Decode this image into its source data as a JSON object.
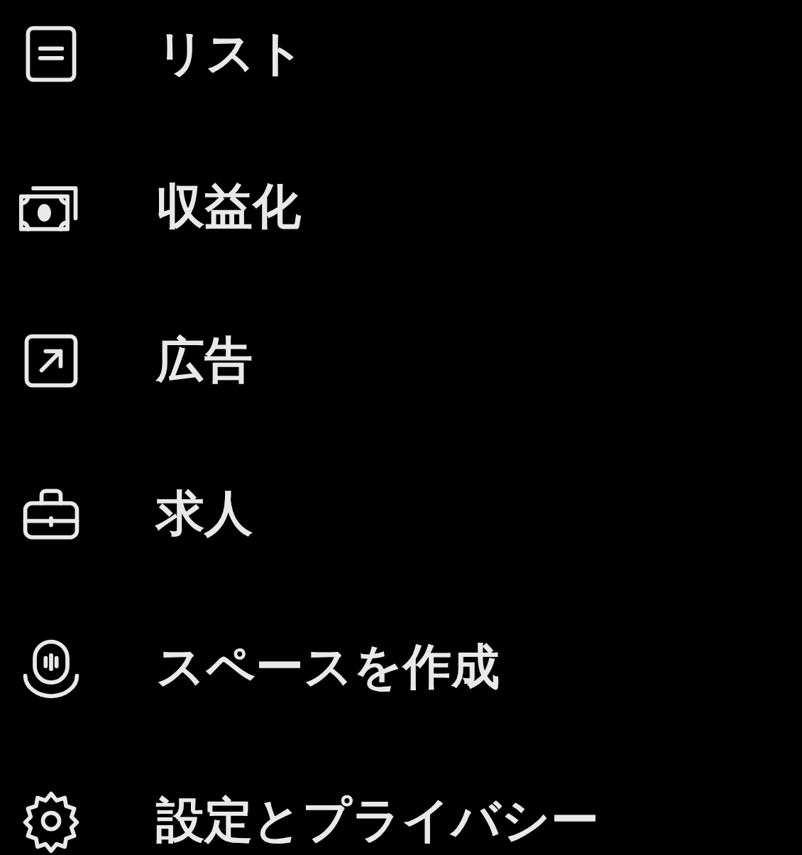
{
  "menu": [
    {
      "kind": "list",
      "label": "リスト"
    },
    {
      "kind": "money",
      "label": "収益化"
    },
    {
      "kind": "ads",
      "label": "広告"
    },
    {
      "kind": "jobs",
      "label": "求人"
    },
    {
      "kind": "spaces",
      "label": "スペースを作成"
    },
    {
      "kind": "settings",
      "label": "設定とプライバシー"
    }
  ]
}
